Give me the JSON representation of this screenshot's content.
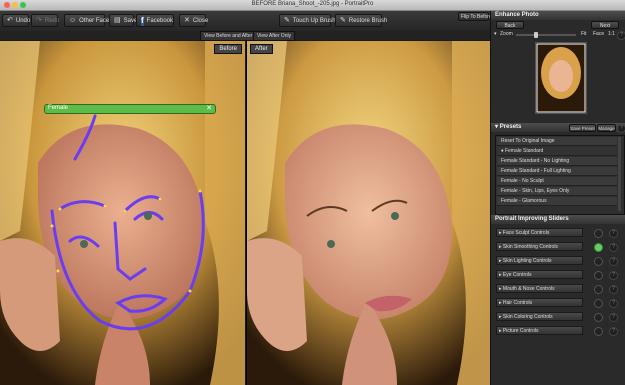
{
  "window": {
    "title": "BEFORE Briana_Shoot_-205.jpg - PortraitPro"
  },
  "toolbar": {
    "undo": "Undo",
    "redo": "Redo",
    "other_faces": "Other Faces",
    "save": "Save",
    "facebook": "Facebook",
    "close": "Close",
    "touch_up": "Touch Up Brush",
    "restore": "Restore Brush",
    "flip": "Flip To Before"
  },
  "view": {
    "before_after": "View Before and After",
    "after_only": "View After Only"
  },
  "labels": {
    "before": "Before",
    "after": "After"
  },
  "face_tag": "Female",
  "enhance": {
    "title": "Enhance Photo",
    "back": "Back",
    "next": "Next",
    "zoom": "Zoom",
    "fit": "Fit",
    "face": "Face",
    "ratio": "1:1"
  },
  "presets": {
    "title": "Presets",
    "save": "Save Preset",
    "manage": "Manage",
    "items": [
      "Reset To Original Image",
      "Female Standard",
      "Female Standard - No Lighting",
      "Female Standard - Full Lighting",
      "Female - No Sculpt",
      "Female - Skin, Lips, Eyes Only",
      "Female - Glamorous"
    ]
  },
  "sliders": {
    "title": "Portrait Improving Sliders",
    "items": [
      "Face Sculpt Controls",
      "Skin Smoothing Controls",
      "Skin Lighting Controls",
      "Eye Controls",
      "Mouth & Nose Controls",
      "Hair Controls",
      "Skin Coloring Controls",
      "Picture Controls"
    ],
    "active_index": 1
  },
  "colors": {
    "accent_green": "#5dbb4a",
    "outline_purple": "#6a3df0"
  }
}
